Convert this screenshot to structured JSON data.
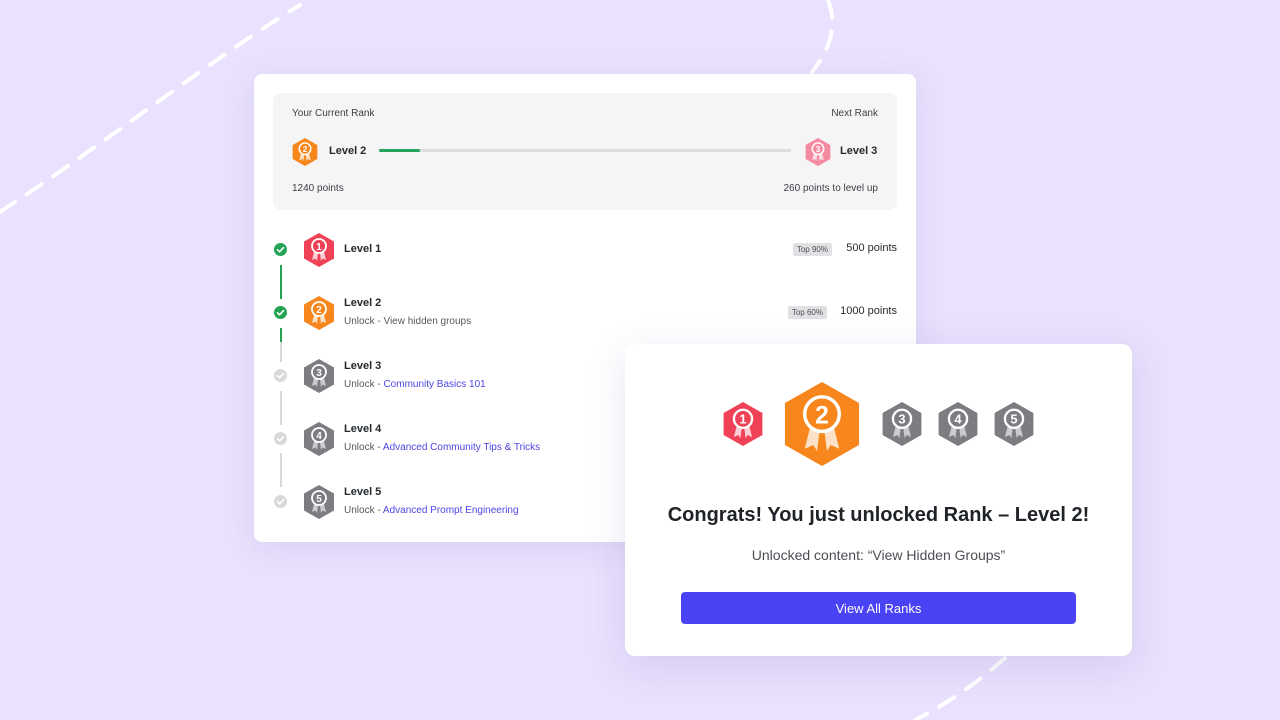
{
  "current_rank": {
    "left_label": "Your Current Rank",
    "right_label": "Next Rank",
    "current_level": "Level 2",
    "next_level": "Level 3",
    "current_badge_number": "2",
    "next_badge_number": "3",
    "progress": 0.1,
    "points": "1240 points",
    "points_to_level": "260 points to level up"
  },
  "levels": [
    {
      "title": "Level 1",
      "number": "1",
      "status": "completed",
      "unlock_prefix": "",
      "unlock_text": "",
      "top": "Top 90%",
      "points": "500 points",
      "color": "#f04257"
    },
    {
      "title": "Level 2",
      "number": "2",
      "status": "completed",
      "unlock_prefix": "Unlock - ",
      "unlock_text": "View hidden groups",
      "top": "Top 60%",
      "points": "1000 points",
      "color": "#f7861c"
    },
    {
      "title": "Level 3",
      "number": "3",
      "status": "locked",
      "unlock_prefix": "Unlock - ",
      "unlock_text": "Community Basics 101",
      "color": "#7b7d81"
    },
    {
      "title": "Level 4",
      "number": "4",
      "status": "locked",
      "unlock_prefix": "Unlock - ",
      "unlock_text": "Advanced Community Tips & Tricks",
      "color": "#7b7d81"
    },
    {
      "title": "Level 5",
      "number": "5",
      "status": "locked",
      "unlock_prefix": "Unlock - ",
      "unlock_text": "Advanced Prompt Engineering",
      "color": "#7b7d81"
    }
  ],
  "popup": {
    "badges": [
      "1",
      "2",
      "3",
      "4",
      "5"
    ],
    "title": "Congrats! You just unlocked Rank – Level 2!",
    "subtitle": "Unlocked content: “View Hidden Groups”",
    "button": "View All Ranks"
  },
  "colors": {
    "level1": "#f04257",
    "level2": "#f7861c",
    "level3": "#f48ba0",
    "locked": "#7b7d81",
    "accent": "#4a42f5",
    "success": "#23a455"
  }
}
